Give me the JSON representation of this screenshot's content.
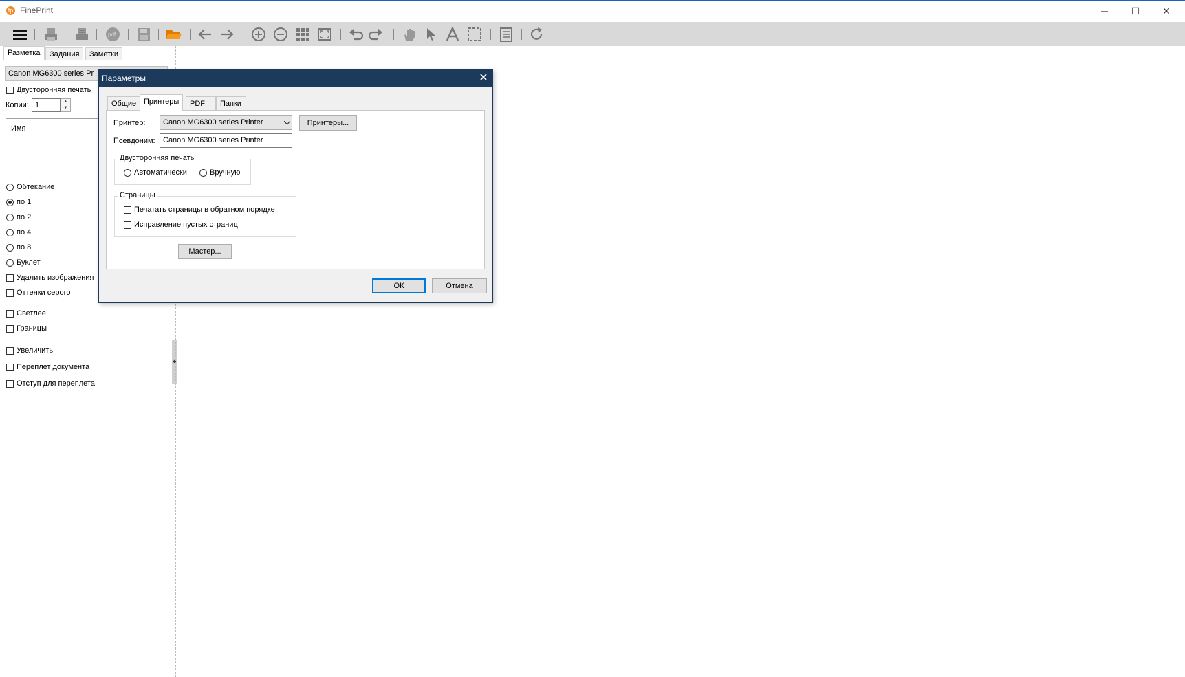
{
  "app": {
    "title": "FinePrint",
    "logo_letter": "fp",
    "accent_color": "#1565c0",
    "window_controls": {
      "minimize": "─",
      "maximize": "☐",
      "close": "✕"
    }
  },
  "toolbar": {
    "icons": [
      "menu-icon",
      "print-icon",
      "print-settings-icon",
      "pdf-icon",
      "save-icon",
      "open-folder-icon",
      "back-arrow-icon",
      "forward-arrow-icon",
      "zoom-in-icon",
      "zoom-out-icon",
      "grid-icon",
      "fit-page-icon",
      "undo-icon",
      "redo-icon",
      "hand-icon",
      "pointer-icon",
      "text-icon",
      "select-rect-icon",
      "notes-icon",
      "refresh-icon"
    ]
  },
  "left_panel": {
    "tabs": [
      "Разметка",
      "Задания",
      "Заметки"
    ],
    "active_tab": "Разметка",
    "printer_select": "Canon MG6300 series Pr",
    "duplex_label": "Двусторонняя печать",
    "copies_label": "Копии:",
    "copies_value": "1",
    "names_header": "Имя",
    "layout_options": [
      {
        "label": "Обтекание",
        "selected": false
      },
      {
        "label": "по 1",
        "selected": true
      },
      {
        "label": "по 2",
        "selected": false
      },
      {
        "label": "по 4",
        "selected": false
      },
      {
        "label": "по 8",
        "selected": false
      },
      {
        "label": "Буклет",
        "selected": false
      }
    ],
    "checkboxes_a": [
      "Удалить изображения",
      "Оттенки серого"
    ],
    "checkboxes_b": [
      "Светлее",
      "Границы"
    ],
    "checkboxes_c": [
      "Увеличить",
      "Переплет документа",
      "Отступ для переплета"
    ]
  },
  "dialog": {
    "title": "Параметры",
    "close": "✕",
    "tabs": [
      "Общие",
      "Принтеры",
      "PDF",
      "Папки"
    ],
    "active_tab": "Принтеры",
    "printer_label": "Принтер:",
    "printer_value": "Canon MG6300 series Printer",
    "printers_button": "Принтеры...",
    "alias_label": "Псевдоним:",
    "alias_value": "Canon MG6300 series Printer",
    "duplex_group": {
      "title": "Двусторонняя печать",
      "options": [
        "Автоматически",
        "Вручную"
      ]
    },
    "pages_group": {
      "title": "Страницы",
      "options": [
        "Печатать страницы в обратном порядке",
        "Исправление пустых страниц"
      ]
    },
    "wizard_button": "Мастер...",
    "ok_button": "ОК",
    "cancel_button": "Отмена"
  }
}
